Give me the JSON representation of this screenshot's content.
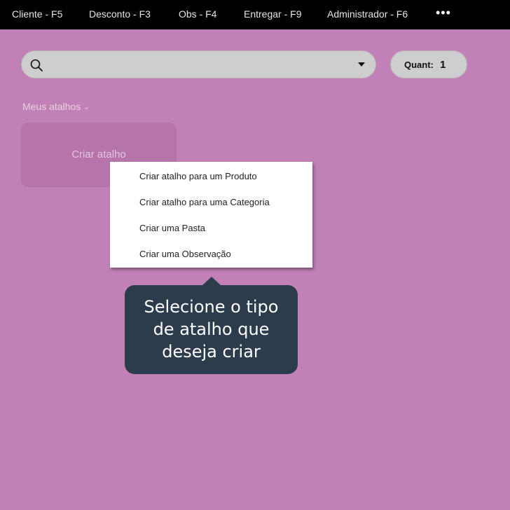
{
  "topbar": {
    "items": [
      "Cliente - F5",
      "Desconto - F3",
      "Obs - F4",
      "Entregar - F9",
      "Administrador - F6"
    ],
    "more_icon": "more-horizontal-icon",
    "more_label": "•••"
  },
  "search": {
    "value": "",
    "placeholder": "",
    "icon": "search-icon",
    "dropdown_icon": "caret-down-icon"
  },
  "quantity": {
    "label": "Quant:",
    "value": "1"
  },
  "shortcuts": {
    "section_label": "Meus atalhos",
    "section_icon": "chevron-down-icon",
    "create_card_label": "Criar atalho"
  },
  "context_menu": {
    "items": [
      "Criar atalho para um Produto",
      "Criar atalho para uma Categoria",
      "Criar uma Pasta",
      "Criar uma Observação"
    ]
  },
  "tooltip": {
    "lines": [
      "Selecione o tipo",
      "de atalho que",
      "deseja criar"
    ]
  },
  "colors": {
    "background": "#c181b6",
    "topbar": "#000000",
    "tooltip": "#2d3c4c",
    "input": "#cecece"
  }
}
